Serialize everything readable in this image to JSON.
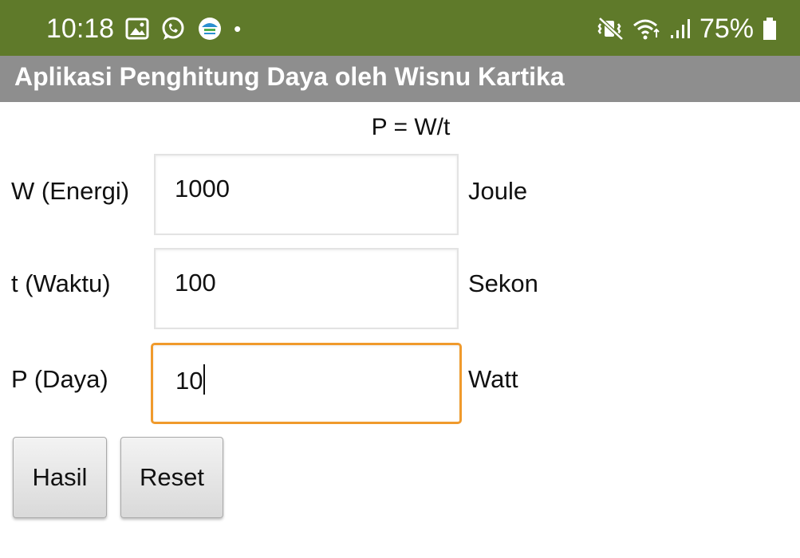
{
  "status_bar": {
    "time": "10:18",
    "icons_left": [
      "image-icon",
      "whatsapp-icon",
      "bmkg-icon",
      "notification-dot-icon"
    ],
    "dot": "•",
    "icons_right": [
      "mute-vibrate-icon",
      "wifi-icon",
      "signal-icon",
      "battery-icon"
    ],
    "battery": "75%",
    "color": "#5f7a2a"
  },
  "app": {
    "title": "Aplikasi Penghitung Daya oleh Wisnu Kartika",
    "title_bar_color": "#8e8e8e"
  },
  "formula": "P = W/t",
  "rows": [
    {
      "label": "W (Energi)",
      "value": "1000",
      "unit": "Joule"
    },
    {
      "label": "t (Waktu)",
      "value": "100",
      "unit": "Sekon"
    },
    {
      "label": "P (Daya)",
      "value": "10",
      "unit": "Watt",
      "focused": true
    }
  ],
  "buttons": {
    "hasil": "Hasil",
    "reset": "Reset"
  },
  "colors": {
    "focus_border": "#f09a2c"
  }
}
